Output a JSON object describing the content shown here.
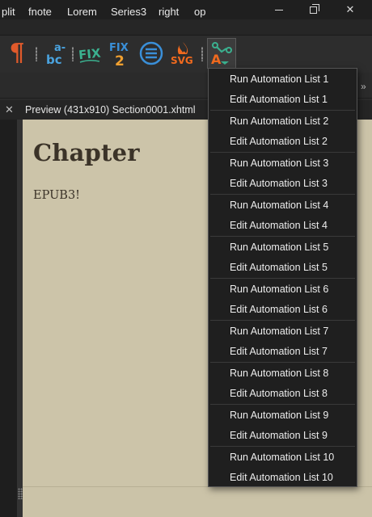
{
  "window": {
    "minimize_label": "–",
    "close_label": "✕"
  },
  "toolbar": {
    "icons": [
      {
        "name": "pilcrow-icon",
        "glyph": "¶",
        "color": "#e05a2b"
      },
      {
        "name": "abc-hyphenate-icon",
        "text_top": "a-",
        "text_bottom": "bc",
        "color": "#4aa3df"
      },
      {
        "name": "fix-icon",
        "text": "FIX",
        "color": "#3bb08f"
      },
      {
        "name": "fix2-icon",
        "text_top": "FIX",
        "text_bottom": "2",
        "color_top": "#3a8fd8",
        "color_bottom": "#f0a030"
      },
      {
        "name": "list-circle-icon",
        "color": "#3a8fd8"
      },
      {
        "name": "svg-icon",
        "text": "SVG",
        "color": "#f06a1e"
      },
      {
        "name": "automation-icon",
        "color_primary": "#3bb08f",
        "color_secondary": "#f06a1e"
      }
    ]
  },
  "clipbar": {
    "items": [
      "plit",
      "fnote",
      "Lorem",
      "Series3",
      "right",
      "op"
    ],
    "more_label": "»"
  },
  "tabs": {
    "close_glyph": "✕",
    "preview_title": "Preview (431x910) Section0001.xhtml"
  },
  "preview": {
    "heading": "Chapter",
    "body": "EPUB3!",
    "background": "#ccc4a9"
  },
  "dropdown": {
    "items": [
      "Run Automation List 1",
      "Edit Automation List 1",
      "Run Automation List 2",
      "Edit Automation List 2",
      "Run Automation List 3",
      "Edit Automation List 3",
      "Run Automation List 4",
      "Edit Automation List 4",
      "Run Automation List 5",
      "Edit Automation List 5",
      "Run Automation List 6",
      "Edit Automation List 6",
      "Run Automation List 7",
      "Edit Automation List 7",
      "Run Automation List 8",
      "Edit Automation List 8",
      "Run Automation List 9",
      "Edit Automation List 9",
      "Run Automation List 10",
      "Edit Automation List 10"
    ]
  }
}
